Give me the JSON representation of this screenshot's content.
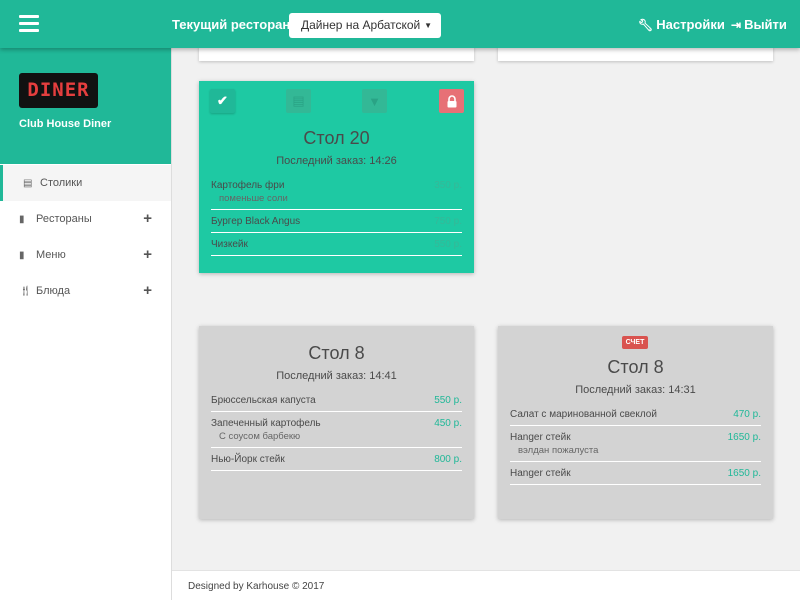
{
  "header": {
    "current_label": "Текущий ресторан:",
    "selected_restaurant": "Дайнер на Арбатской",
    "settings_label": "Настройки",
    "logout_label": "Выйти"
  },
  "sidebar": {
    "logo_text": "DINER",
    "brand_name": "Club House Diner",
    "items": [
      {
        "label": "Столики"
      },
      {
        "label": "Рестораны"
      },
      {
        "label": "Меню"
      },
      {
        "label": "Блюда"
      }
    ]
  },
  "cards": [
    {
      "title": "Стол 20",
      "last_order": "Последний заказ: 14:26",
      "items": [
        {
          "name": "Картофель фри",
          "price": "350 р.",
          "note": "поменьше соли"
        },
        {
          "name": "Бургер Black Angus",
          "price": "750 р."
        },
        {
          "name": "Чизкейк",
          "price": "550 р."
        }
      ]
    },
    {
      "title": "Стол 8",
      "last_order": "Последний заказ: 14:41",
      "items": [
        {
          "name": "Брюссельская капуста",
          "price": "550 р."
        },
        {
          "name": "Запеченный картофель",
          "price": "450 р.",
          "note": "С соусом барбекю"
        },
        {
          "name": "Нью-Йорк стейк",
          "price": "800 р."
        }
      ]
    },
    {
      "badge": "СЧЕТ",
      "title": "Стол 8",
      "last_order": "Последний заказ: 14:31",
      "items": [
        {
          "name": "Салат с маринованной свеклой",
          "price": "470 р."
        },
        {
          "name": "Hanger стейк",
          "price": "1650 р.",
          "note": "вэлдан пожалуста"
        },
        {
          "name": "Hanger стейк",
          "price": "1650 р."
        }
      ]
    }
  ],
  "footer": {
    "text": "Designed by Karhouse © 2017"
  },
  "colors": {
    "accent": "#20b898",
    "card_active": "#1ec9a3",
    "card_idle": "#d3d3d3",
    "badge": "#d9534f",
    "lock": "#e77076"
  }
}
